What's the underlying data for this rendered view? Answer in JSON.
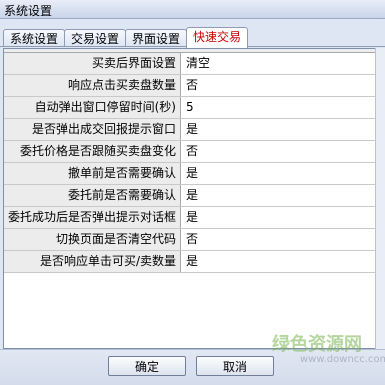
{
  "window": {
    "title": "系统设置"
  },
  "tabs": [
    {
      "label": "系统设置",
      "active": false
    },
    {
      "label": "交易设置",
      "active": false
    },
    {
      "label": "界面设置",
      "active": false
    },
    {
      "label": "快速交易",
      "active": true
    }
  ],
  "settings": [
    {
      "label": "买卖后界面设置",
      "value": "清空"
    },
    {
      "label": "响应点击买卖盘数量",
      "value": "否"
    },
    {
      "label": "自动弹出窗口停留时间(秒)",
      "value": "5"
    },
    {
      "label": "是否弹出成交回报提示窗口",
      "value": "是"
    },
    {
      "label": "委托价格是否跟随买卖盘变化",
      "value": "否"
    },
    {
      "label": "撤单前是否需要确认",
      "value": "是"
    },
    {
      "label": "委托前是否需要确认",
      "value": "是"
    },
    {
      "label": "委托成功后是否弹出提示对话框",
      "value": "是"
    },
    {
      "label": "切换页面是否清空代码",
      "value": "否"
    },
    {
      "label": "是否响应单击可买/卖数量",
      "value": "是"
    }
  ],
  "buttons": {
    "ok": "确定",
    "cancel": "取消"
  },
  "watermark": {
    "text": "绿色资源网",
    "sub": "www.downcc.com"
  }
}
